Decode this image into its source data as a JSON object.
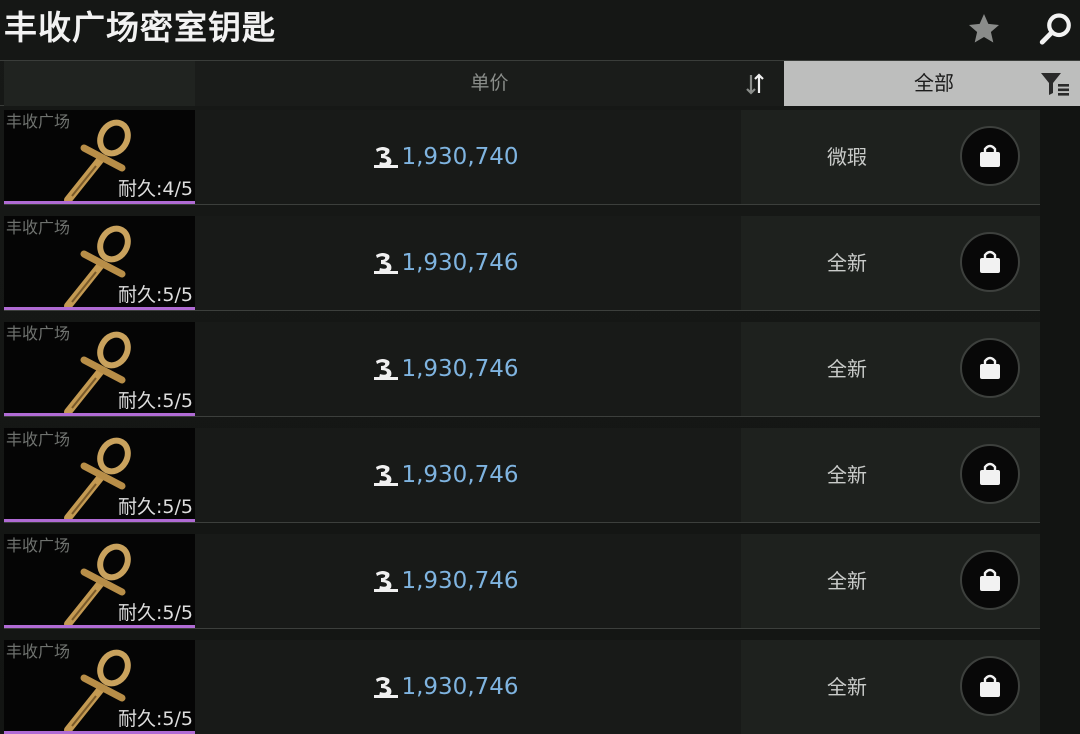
{
  "title": "丰收广场密室钥匙",
  "header": {
    "price_label": "单价",
    "filter_label": "全部"
  },
  "icons": {
    "favorite": "star-icon",
    "search": "search-icon",
    "sort": "sort-arrows-icon",
    "filter": "filter-icon",
    "currency": "coin-icon",
    "buy": "shopping-bag-icon",
    "item": "ankh-key-icon"
  },
  "colors": {
    "price_text": "#7fb4e0",
    "rarity_accent": "#b06bd4",
    "active_tab": "#bdbebd"
  },
  "listings": [
    {
      "market": "丰收广场",
      "durability": "耐久:4/5",
      "price": "1,930,740",
      "condition": "微瑕"
    },
    {
      "market": "丰收广场",
      "durability": "耐久:5/5",
      "price": "1,930,746",
      "condition": "全新"
    },
    {
      "market": "丰收广场",
      "durability": "耐久:5/5",
      "price": "1,930,746",
      "condition": "全新"
    },
    {
      "market": "丰收广场",
      "durability": "耐久:5/5",
      "price": "1,930,746",
      "condition": "全新"
    },
    {
      "market": "丰收广场",
      "durability": "耐久:5/5",
      "price": "1,930,746",
      "condition": "全新"
    },
    {
      "market": "丰收广场",
      "durability": "耐久:5/5",
      "price": "1,930,746",
      "condition": "全新"
    }
  ]
}
